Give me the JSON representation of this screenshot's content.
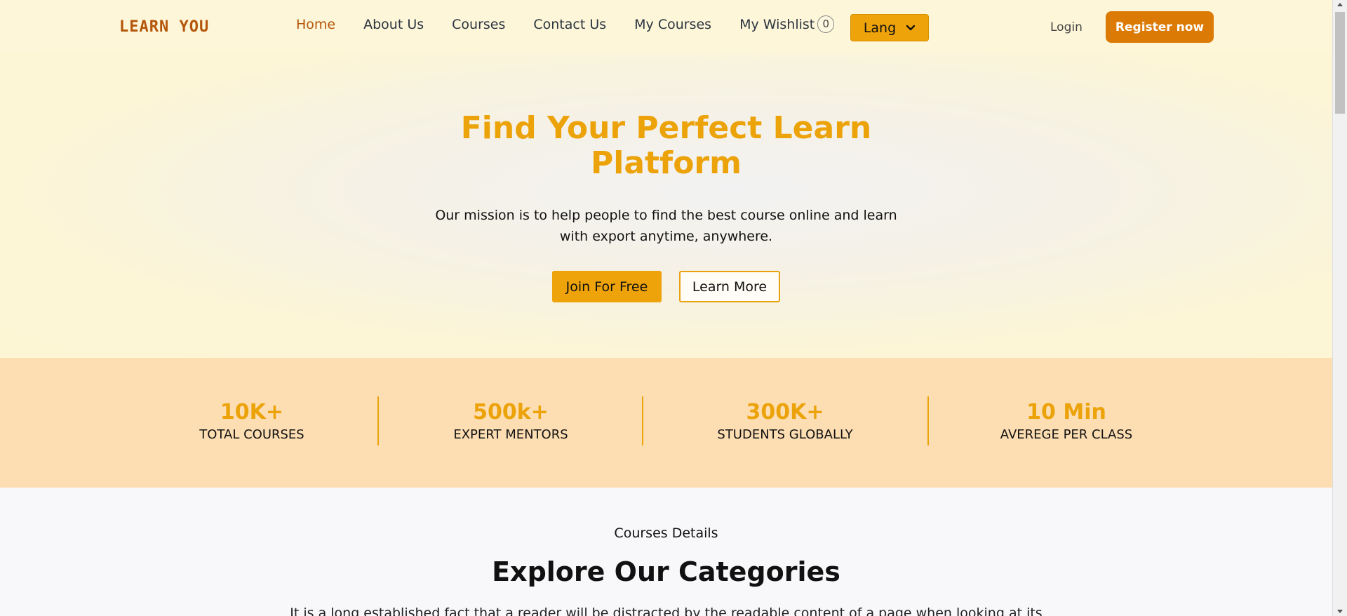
{
  "header": {
    "logo": "LEARN YOU",
    "nav": [
      {
        "label": "Home",
        "active": true
      },
      {
        "label": "About Us",
        "active": false
      },
      {
        "label": "Courses",
        "active": false
      },
      {
        "label": "Contact Us",
        "active": false
      },
      {
        "label": "My Courses",
        "active": false
      }
    ],
    "wishlist_label": "My Wishlist",
    "wishlist_count": "0",
    "lang_label": "Lang",
    "login_label": "Login",
    "register_label": "Register now"
  },
  "hero": {
    "title_line1": "Find Your Perfect Learn",
    "title_line2": "Platform",
    "subtitle_line1": "Our mission is to help people to find the best course online and learn",
    "subtitle_line2": "with export anytime, anywhere.",
    "primary_button": "Join For Free",
    "secondary_button": "Learn More"
  },
  "stats": [
    {
      "value": "10K+",
      "label": "TOTAL COURSES"
    },
    {
      "value": "500k+",
      "label": "EXPERT MENTORS"
    },
    {
      "value": "300K+",
      "label": "STUDENTS GLOBALLY"
    },
    {
      "value": "10 Min",
      "label": "AVEREGE PER CLASS"
    }
  ],
  "categories": {
    "kicker": "Courses Details",
    "title": "Explore Our Categories",
    "text": "It is a long established fact that a reader will be distracted by the readable content of a page when looking at its"
  },
  "colors": {
    "accent": "#eca30a",
    "brand": "#b4560a",
    "register": "#dc7a06",
    "stats_bg": "#fddeb3"
  }
}
